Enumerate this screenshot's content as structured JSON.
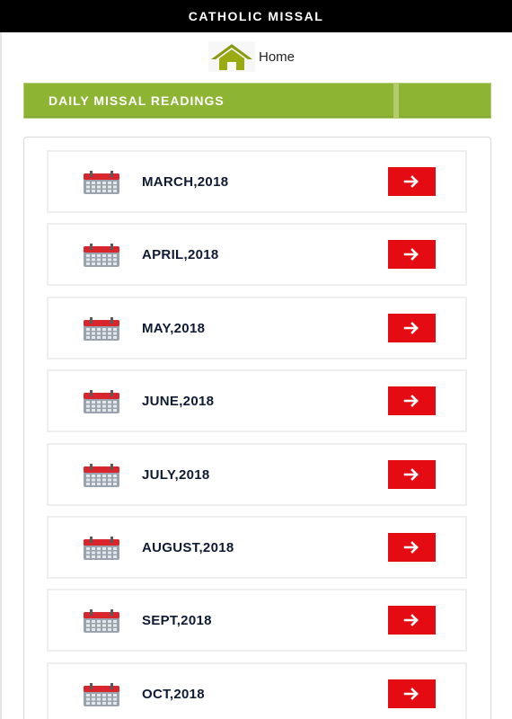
{
  "app": {
    "title": "CATHOLIC MISSAL"
  },
  "nav": {
    "home_label": "Home"
  },
  "section": {
    "title": "DAILY MISSAL READINGS"
  },
  "months": [
    {
      "label": "MARCH,2018"
    },
    {
      "label": "APRIL,2018"
    },
    {
      "label": "MAY,2018"
    },
    {
      "label": "JUNE,2018"
    },
    {
      "label": "JULY,2018"
    },
    {
      "label": "AUGUST,2018"
    },
    {
      "label": "SEPT,2018"
    },
    {
      "label": "OCT,2018"
    }
  ],
  "icons": {
    "home": "home-icon",
    "month": "calendar-icon",
    "go": "arrow-right-icon"
  },
  "colors": {
    "top_bar": "#000000",
    "section_header": "#8db533",
    "go_button": "#e40b13",
    "home_icon": "#8a9a0f"
  }
}
